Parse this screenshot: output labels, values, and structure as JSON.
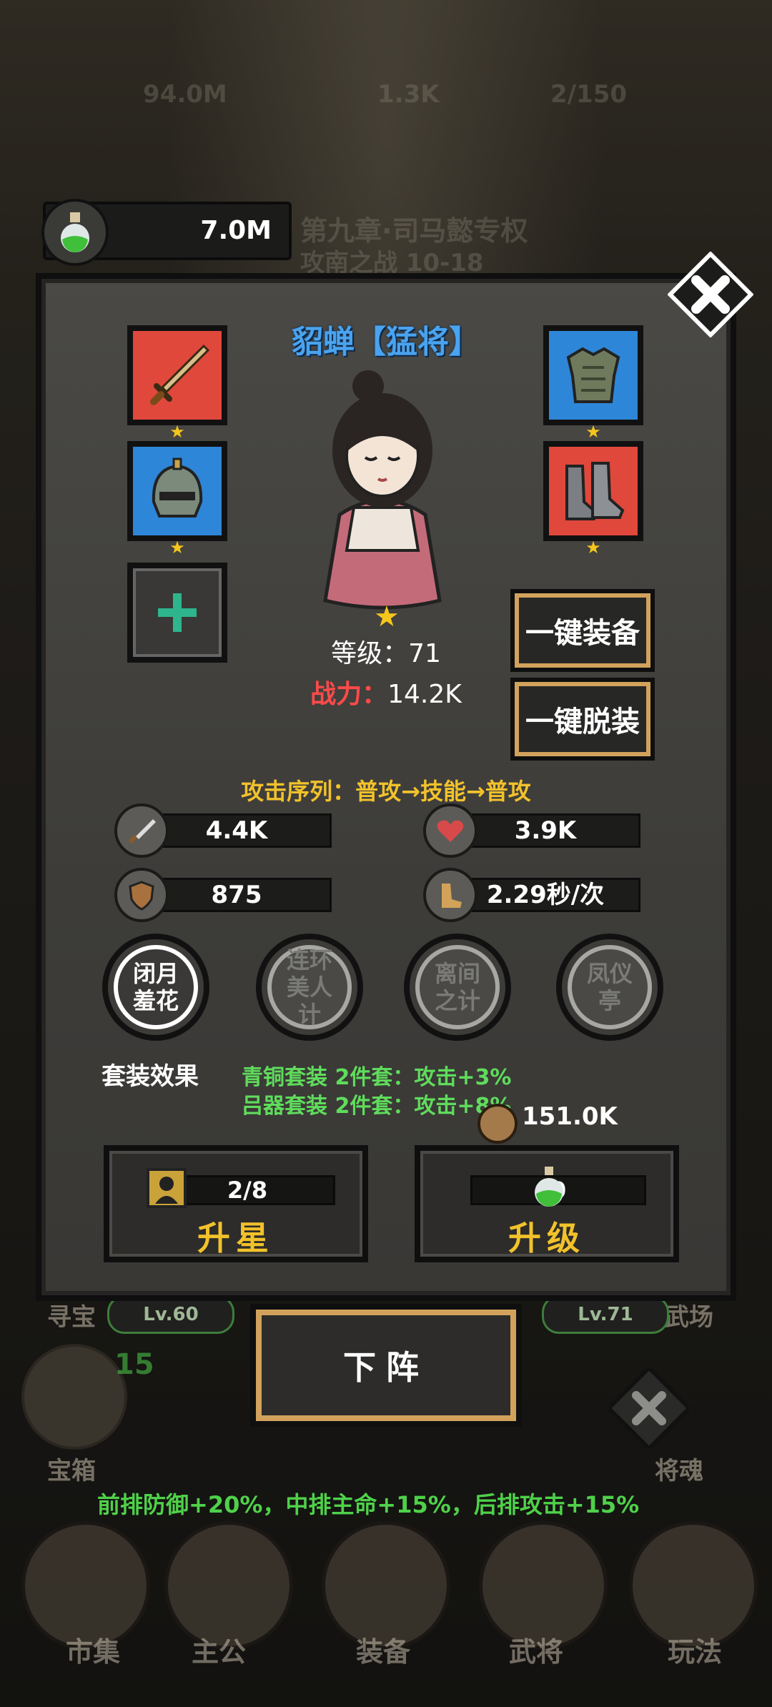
{
  "resource": {
    "value": "7.0M",
    "icon": "potion-icon"
  },
  "background": {
    "top_left_value": "94.0M",
    "top_mid_value": "1.3K",
    "top_right_value": "2/150",
    "stage_title": "第九章·司马懿专权",
    "stage_sub": "攻南之战 10-18",
    "left_level": "Lv.60",
    "right_level": "Lv.71",
    "left_label_top": "寻宝",
    "right_label_top": "武场",
    "chest_count": "15",
    "chest_label": "宝箱",
    "soul_label": "将魂",
    "formation_bonus": "前排防御+20%，中排主命+15%，后排攻击+15%",
    "nav": [
      "市集",
      "主公",
      "装备",
      "武将",
      "玩法"
    ]
  },
  "hero": {
    "name": "貂蝉【猛将】",
    "level_text": "等级：71",
    "power_label": "战力：",
    "power_value": "14.2K"
  },
  "equipment": [
    {
      "name": "sword",
      "stars": 1,
      "color": "#e0483c"
    },
    {
      "name": "helmet",
      "stars": 1,
      "color": "#2e86d8"
    },
    {
      "name": "armor",
      "stars": 1,
      "color": "#2e86d8"
    },
    {
      "name": "boots",
      "stars": 1,
      "color": "#e0483c"
    }
  ],
  "buttons": {
    "equip_all": "一键装备",
    "unequip_all": "一键脱装",
    "star_up": "升星",
    "level_up": "升级",
    "leave": "下阵"
  },
  "attack_sequence": "攻击序列：普攻→技能→普攻",
  "stats": {
    "attack": "4.4K",
    "hp": "3.9K",
    "defense": "875",
    "speed": "2.29秒/次"
  },
  "skills": [
    {
      "label": "闭月\n羞花",
      "active": true
    },
    {
      "label": "连环\n美人\n计",
      "active": false
    },
    {
      "label": "离间\n之计",
      "active": false
    },
    {
      "label": "凤仪\n亭",
      "active": false
    }
  ],
  "set_effects": {
    "label": "套装效果",
    "lines": [
      "青铜套装 2件套：攻击+3%",
      "吕器套装 2件套：攻击+8%"
    ]
  },
  "coins": "151.0K",
  "star_material": "2/8",
  "level_material": "0"
}
